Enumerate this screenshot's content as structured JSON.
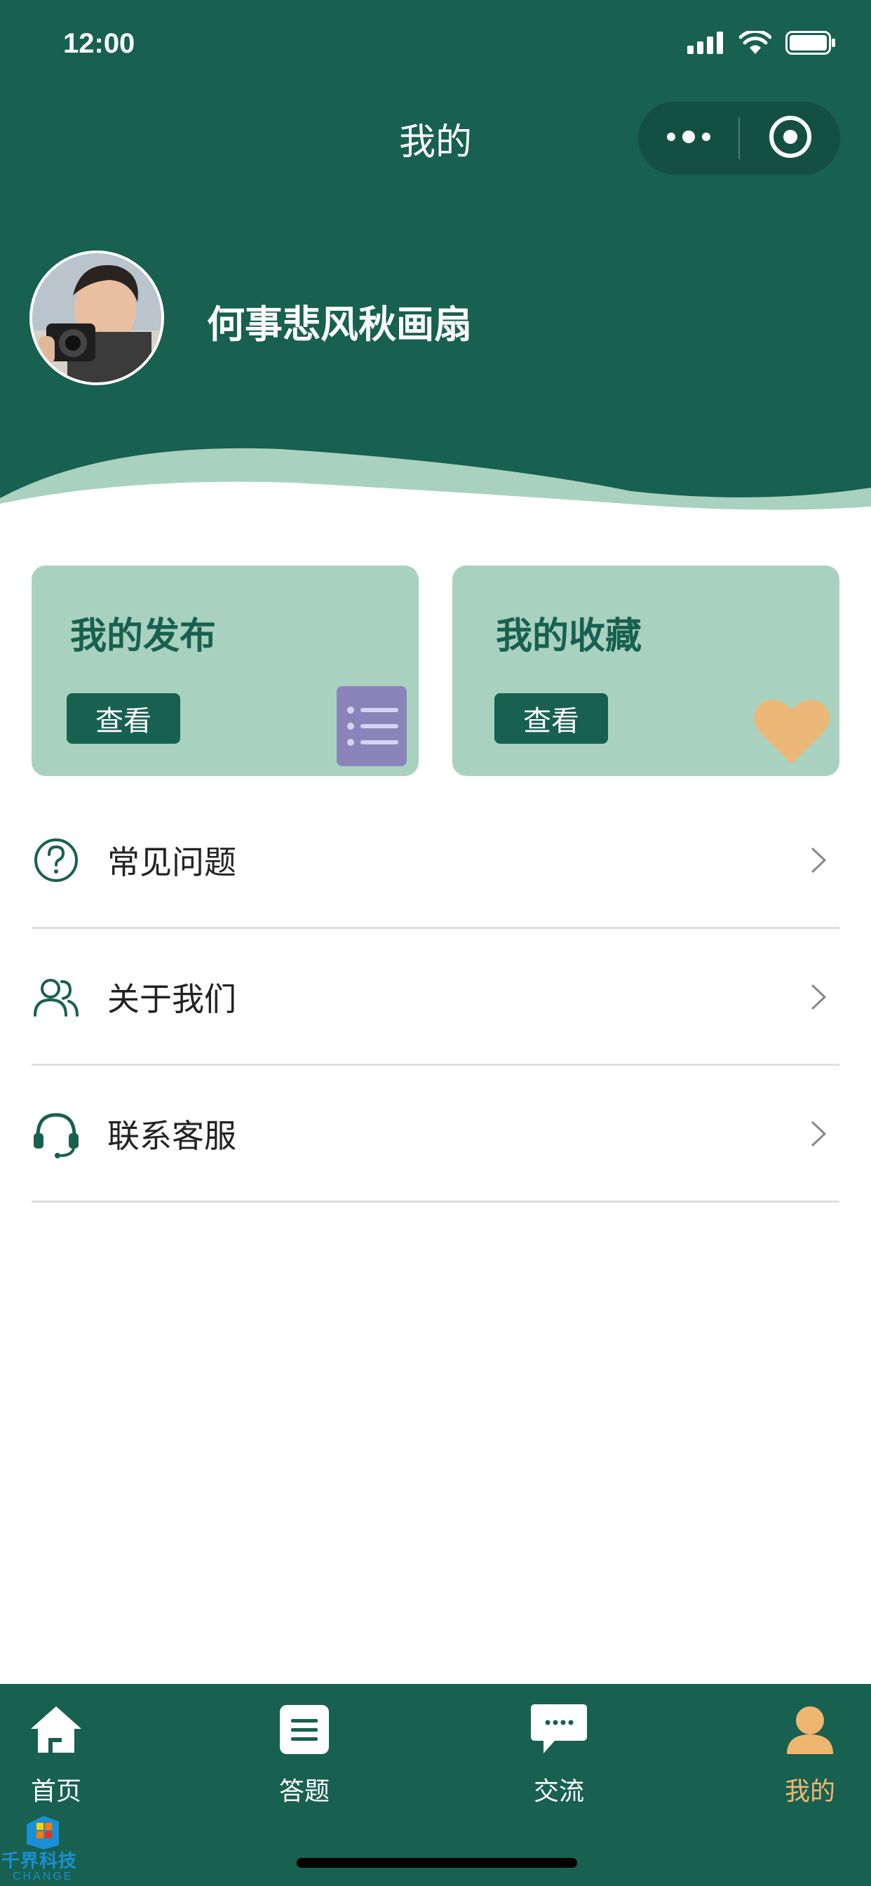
{
  "status_bar": {
    "time": "12:00"
  },
  "nav": {
    "title": "我的"
  },
  "profile": {
    "username": "何事悲风秋画扇"
  },
  "cards": [
    {
      "title": "我的发布",
      "button_label": "查看",
      "icon": "list-icon",
      "icon_color": "#8b84bb"
    },
    {
      "title": "我的收藏",
      "button_label": "查看",
      "icon": "heart-icon",
      "icon_color": "#ecb878"
    }
  ],
  "menu": [
    {
      "label": "常见问题",
      "icon": "question-icon"
    },
    {
      "label": "关于我们",
      "icon": "users-icon"
    },
    {
      "label": "联系客服",
      "icon": "headset-icon"
    }
  ],
  "tabbar": {
    "items": [
      {
        "label": "首页",
        "icon": "home-icon"
      },
      {
        "label": "答题",
        "icon": "answer-icon"
      },
      {
        "label": "交流",
        "icon": "chat-icon"
      },
      {
        "label": "我的",
        "icon": "profile-icon"
      }
    ],
    "active_index": 3
  },
  "watermark": {
    "text": "千界科技",
    "sub": "CHANGE"
  },
  "colors": {
    "primary": "#18604f",
    "card_bg": "#a9d1bf",
    "active_tab": "#efb672"
  }
}
